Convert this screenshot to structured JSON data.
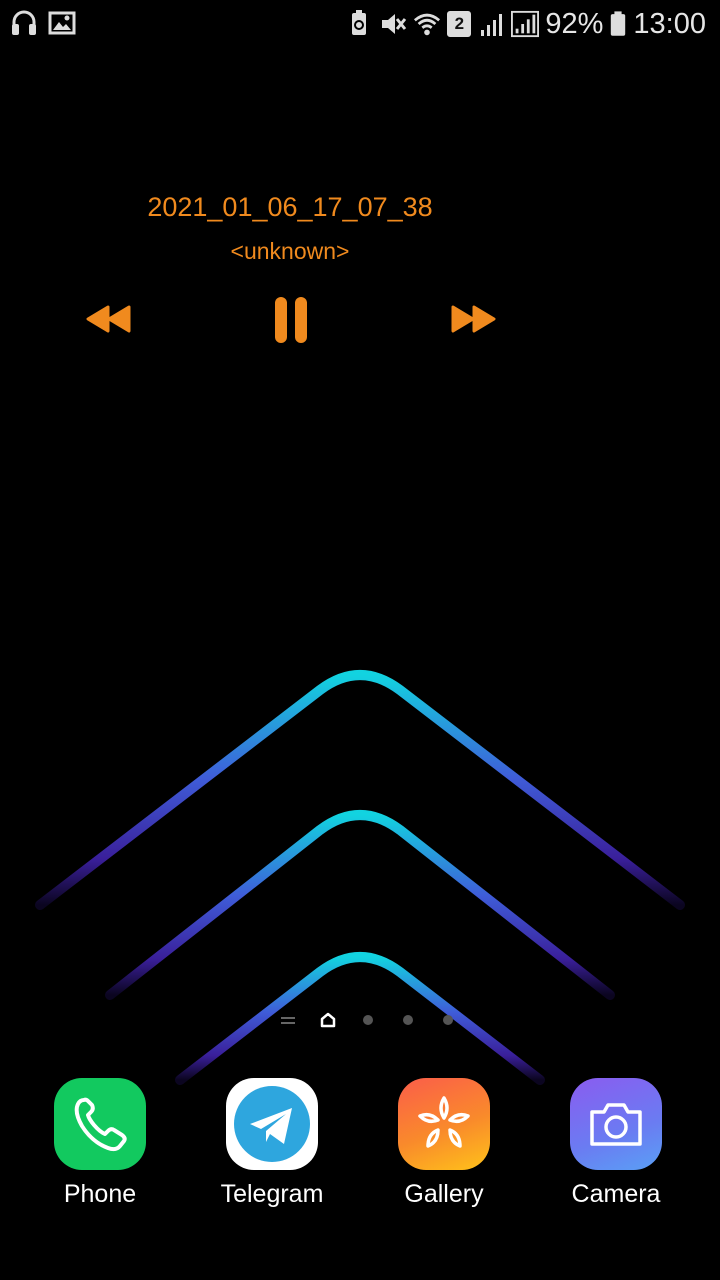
{
  "status_bar": {
    "battery": "92%",
    "time": "13:00",
    "sim_slot": "2",
    "left_icons": [
      "headphones-icon",
      "image-icon"
    ],
    "right_icons": [
      "battery-saver-icon",
      "mute-icon",
      "wifi-icon",
      "sim2-icon",
      "signal-icon",
      "signal-icon",
      "battery-icon"
    ]
  },
  "music": {
    "title": "2021_01_06_17_07_38",
    "artist": "<unknown>",
    "accent": "#f08a1e",
    "controls": [
      "rewind-icon",
      "pause-icon",
      "fast-forward-icon"
    ]
  },
  "page_indicator": {
    "items": [
      "menu-lines-icon",
      "home-icon",
      "dot",
      "dot",
      "dot"
    ],
    "active_index": 1
  },
  "dock": {
    "apps": [
      {
        "label": "Phone",
        "icon": "phone-icon",
        "color": "#12c95f"
      },
      {
        "label": "Telegram",
        "icon": "telegram-icon",
        "color": "#2ea6de"
      },
      {
        "label": "Gallery",
        "icon": "gallery-icon",
        "color": "#f7812a"
      },
      {
        "label": "Camera",
        "icon": "camera-icon",
        "color": "#7a6cf0"
      }
    ]
  }
}
